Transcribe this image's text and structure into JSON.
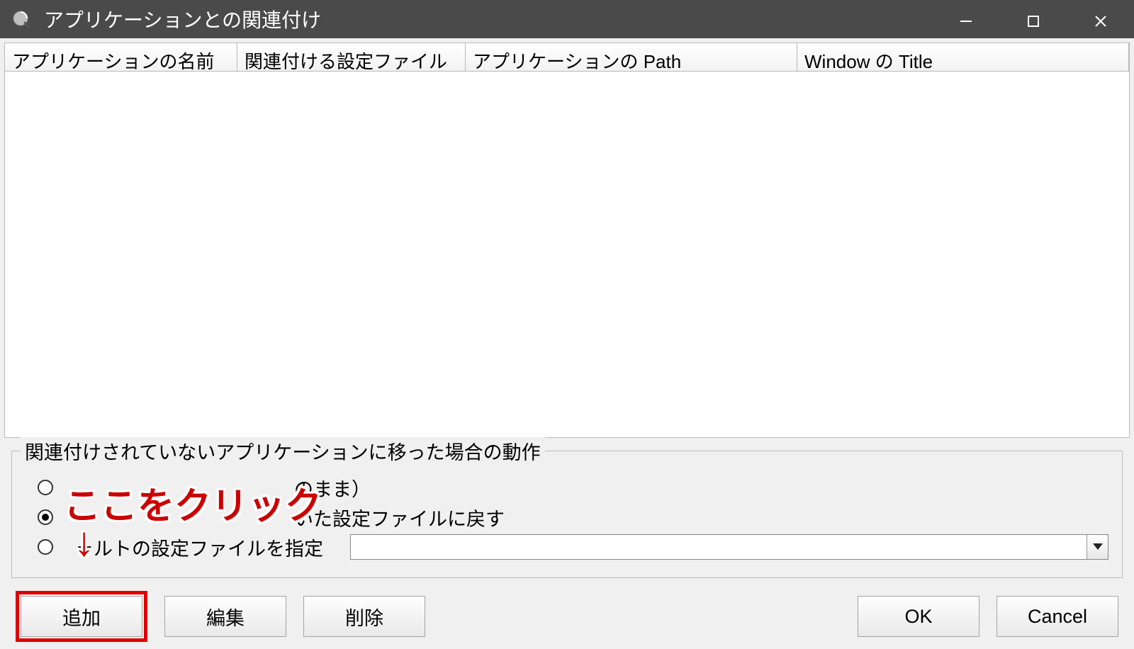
{
  "titlebar": {
    "title": "アプリケーションとの関連付け"
  },
  "table": {
    "columns": [
      "アプリケーションの名前",
      "関連付ける設定ファイル",
      "アプリケーションの Path",
      "Window の Title"
    ]
  },
  "groupbox": {
    "legend": "関連付けされていないアプリケーションに移った場合の動作",
    "options": {
      "opt1_suffix": "のまま）",
      "opt2_suffix": "いた設定ファイルに戻す",
      "opt3_label": "ォルトの設定ファイルを指定"
    },
    "selected_index": 1,
    "combo_value": ""
  },
  "buttons": {
    "add": "追加",
    "edit": "編集",
    "delete": "削除",
    "ok": "OK",
    "cancel": "Cancel"
  },
  "annotation": {
    "text": "ここをクリック",
    "arrow": "↓"
  }
}
